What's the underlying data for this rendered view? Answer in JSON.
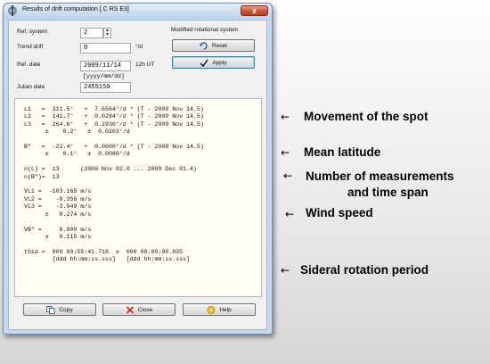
{
  "window": {
    "title": "Results of drift computation [ C RS     E3]",
    "close_glyph": "x"
  },
  "form": {
    "ref_system_label": "Ref. system",
    "ref_system_value": "2",
    "trend_drift_label": "Trend drift",
    "trend_drift_value": "0",
    "trend_drift_unit": "°/d",
    "ref_date_label": "Ref. date",
    "ref_date_value": "2009/11/14",
    "ref_date_suffix": "12h UT",
    "date_format_hint": "[yyyy/mm/dd]",
    "julian_date_label": "Julian date",
    "julian_date_value": "2455150",
    "modified_system_label": "Modified rotational system",
    "reset_label": "Reset",
    "apply_label": "Apply"
  },
  "results": {
    "lines": [
      "L1   =  311.5°   +  7.6564°/d * (T - 2009 Nov 14.5)",
      "L2   =  141.7°   +  0.0264°/d * (T - 2009 Nov 14.5)",
      "L3   =  264.6°   +  0.2930°/d * (T - 2009 Nov 14.5)",
      "      ±    0.2°   ±  0.0203°/d",
      "",
      "B\"   =  -22.4°   +  0.0000°/d * (T - 2009 Nov 14.5)",
      "      ±    0.1°   ±  0.0080°/d",
      "",
      "n(L) =  13      (2009 Nov 02.0 ... 2009 Dec 01.4)",
      "n(B\")=  13",
      "",
      "VL1 =  -103.165 m/s",
      "VL2 =    -0.356 m/s",
      "VL3 =    -3.949 m/s",
      "      ±   0.274 m/s",
      "",
      "VB\" =     0.000 m/s",
      "      ±   0.115 m/s",
      "",
      "tSid =  000 09:55:41.716  ±  000 00:00:00.835",
      "        [ddd hh:mm:ss.sss]   [ddd hh:mm:ss.sss]"
    ]
  },
  "buttons": {
    "copy_label": "Copy",
    "close_label": "Close",
    "help_label": "Help"
  },
  "annotations": {
    "arrow": "←",
    "movement": "Movement of the spot",
    "latitude": "Mean latitude",
    "measurements_line1": "Number of measurements",
    "measurements_line2": "and time span",
    "wind": "Wind speed",
    "sideral": "Sideral rotation period"
  },
  "colors": {
    "result_background": "#fffff4",
    "window_frame": "#c7d9ee",
    "close_button": "#d1553a"
  }
}
